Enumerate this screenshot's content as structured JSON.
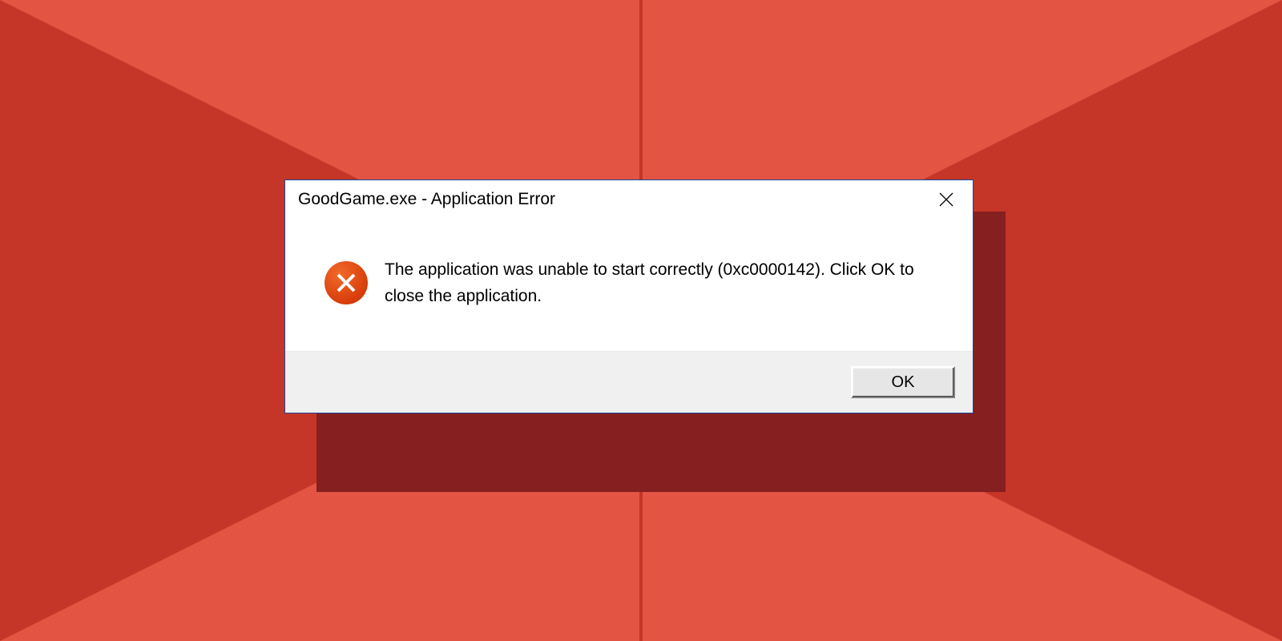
{
  "colors": {
    "bg_dark": "#c53528",
    "bg_light": "#e35443",
    "shadow": "#861f1f",
    "dialog_border": "#1a4a9c",
    "error_icon": "#e04b12"
  },
  "dialog": {
    "title": "GoodGame.exe - Application Error",
    "message": "The application was unable to start correctly (0xc0000142). Click OK to close the application.",
    "ok_label": "OK"
  }
}
